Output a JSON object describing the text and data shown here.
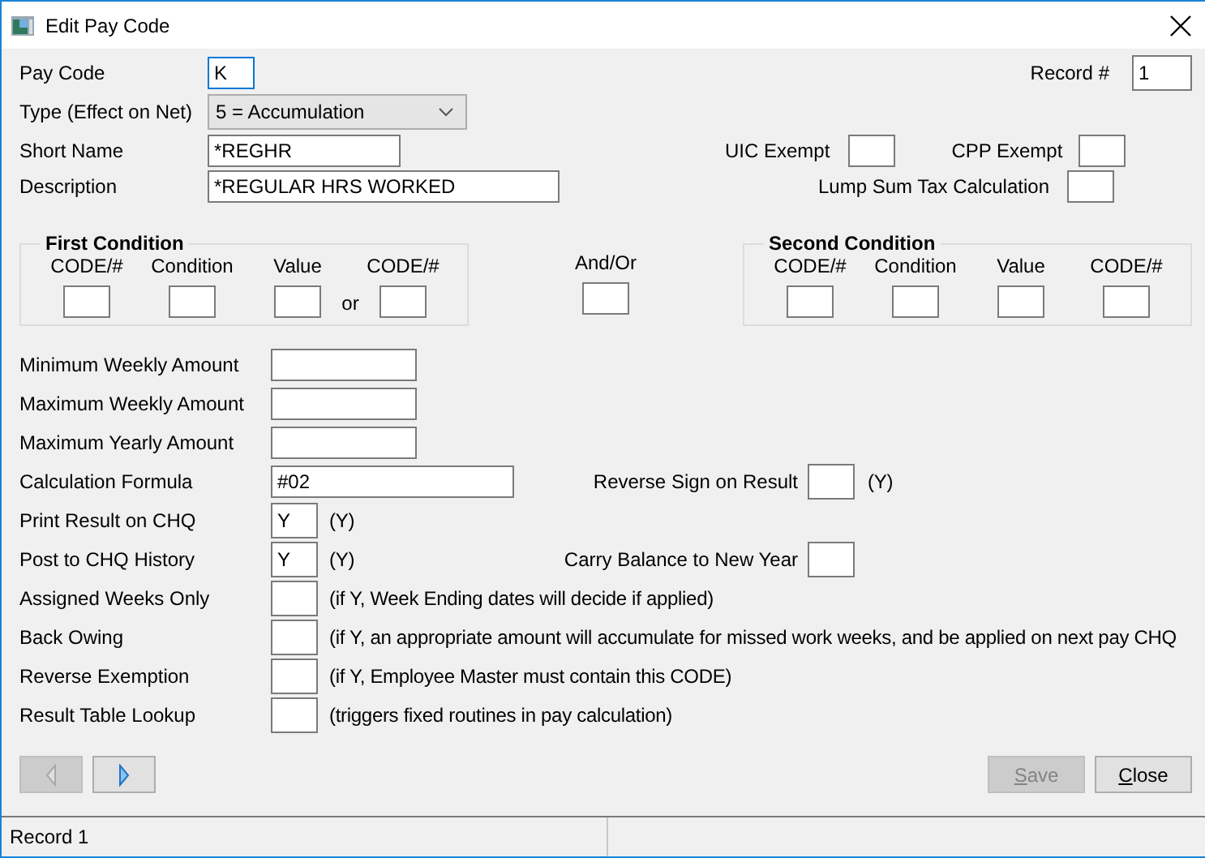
{
  "window": {
    "title": "Edit Pay Code"
  },
  "header": {
    "pay_code": {
      "label": "Pay Code",
      "value": "K",
      "focused": true
    },
    "record": {
      "label": "Record #",
      "value": "1"
    },
    "type": {
      "label": "Type (Effect on Net)",
      "value": "5 = Accumulation"
    },
    "short_name": {
      "label": "Short Name",
      "value": "*REGHR"
    },
    "description": {
      "label": "Description",
      "value": "*REGULAR HRS WORKED"
    },
    "uic_exempt": {
      "label": "UIC Exempt"
    },
    "cpp_exempt": {
      "label": "CPP Exempt"
    },
    "lump_sum": {
      "label": "Lump Sum Tax Calculation"
    }
  },
  "condition_row": [
    {
      "kind": "group",
      "title": "First Condition",
      "fields": [
        {
          "label": "CODE/#"
        },
        {
          "label": "Condition"
        },
        {
          "label": "Value"
        },
        {
          "label": "CODE/#",
          "connector": "or"
        }
      ]
    },
    {
      "kind": "junction",
      "label": "And/Or"
    },
    {
      "kind": "group",
      "title": "Second Condition",
      "fields": [
        {
          "label": "CODE/#"
        },
        {
          "label": "Condition"
        },
        {
          "label": "Value"
        },
        {
          "label": "CODE/#"
        }
      ]
    }
  ],
  "rows": [
    {
      "kind": "amount",
      "label": "Minimum Weekly Amount"
    },
    {
      "kind": "amount",
      "label": "Maximum Weekly Amount"
    },
    {
      "kind": "amount",
      "label": "Maximum Yearly Amount"
    },
    {
      "kind": "formula",
      "label": "Calculation Formula",
      "value": "#02",
      "side": {
        "label": "Reverse Sign on Result",
        "note": "(Y)"
      }
    },
    {
      "kind": "flag",
      "label": "Print Result on CHQ",
      "value": "Y",
      "note": "(Y)"
    },
    {
      "kind": "flag",
      "label": "Post to CHQ History",
      "value": "Y",
      "note": "(Y)",
      "side": {
        "label": "Carry Balance to New Year"
      }
    },
    {
      "kind": "flag",
      "label": "Assigned Weeks Only",
      "note": "(if Y, Week Ending dates will decide if applied)"
    },
    {
      "kind": "flag",
      "label": "Back Owing",
      "note": "(if Y, an appropriate amount will accumulate for missed work weeks, and be applied on next pay CHQ"
    },
    {
      "kind": "flag",
      "label": "Reverse Exemption",
      "note": "(if Y, Employee Master must contain this CODE)"
    },
    {
      "kind": "flag",
      "label": "Result Table Lookup",
      "note": "(triggers fixed routines in pay calculation)"
    }
  ],
  "nav_buttons": [
    {
      "kind": "previous",
      "disabled": true
    },
    {
      "kind": "next",
      "disabled": false
    }
  ],
  "actions": [
    {
      "label": "Save",
      "disabled": true
    },
    {
      "label": "Close",
      "disabled": false
    }
  ],
  "status_bar": {
    "panels": [
      "Record 1"
    ]
  }
}
